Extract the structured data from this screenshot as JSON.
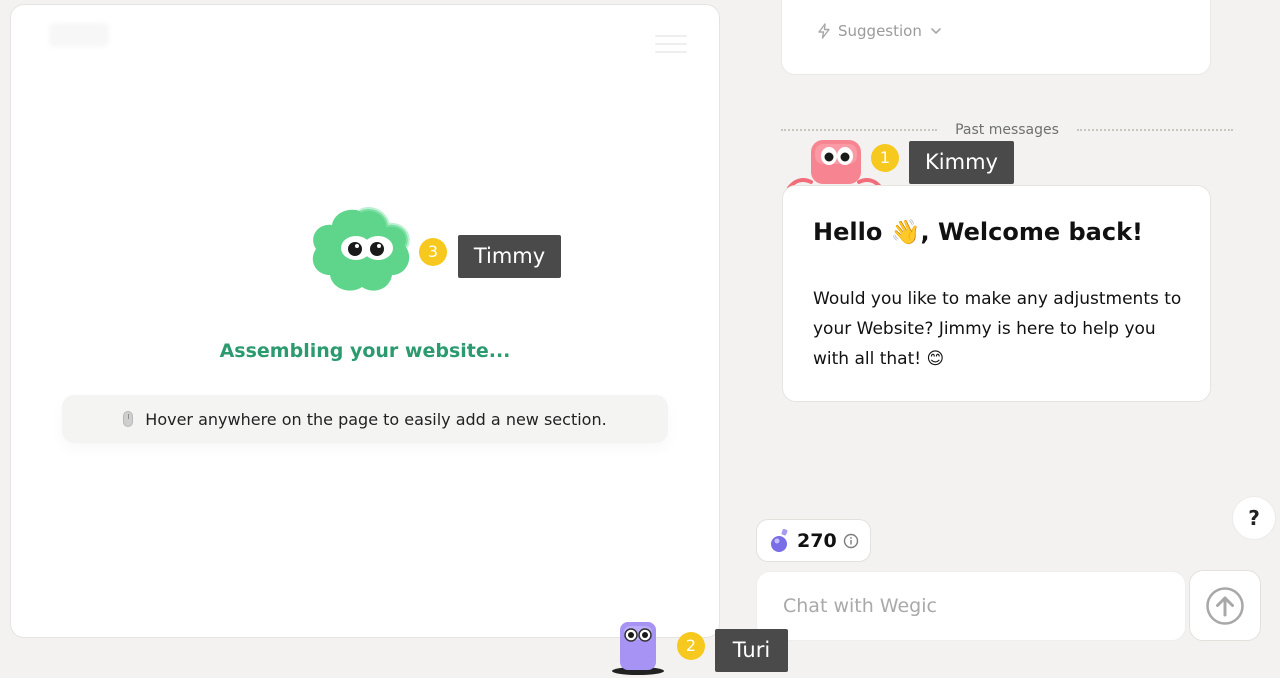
{
  "colors": {
    "accent_green": "#2b9a6f",
    "badge_yellow": "#f7c81e",
    "tag_dark": "#4a4a4a",
    "page_bg": "#f3f2f0"
  },
  "preview": {
    "timmy": {
      "badge": "3",
      "name": "Timmy"
    },
    "status": "Assembling your website...",
    "hint": "Hover anywhere on the page to easily add a new section."
  },
  "chat": {
    "suggestion_label": "Suggestion",
    "past_messages_label": "Past messages",
    "kimmy": {
      "badge": "1",
      "name": "Kimmy"
    },
    "message": {
      "title": "Hello 👋, Welcome back!",
      "body": "Would you like to make any adjustments to your Website? Jimmy is here to help you with all that! 😊"
    },
    "help_label": "?",
    "credits": "270",
    "input_placeholder": "Chat with Wegic"
  },
  "turi": {
    "badge": "2",
    "name": "Turi"
  },
  "icons": {
    "hamburger": "menu-icon",
    "suggestion": "lightning-icon",
    "dropdown": "chevron-down-icon",
    "hint": "mouse-icon",
    "credits": "potion-icon",
    "info": "info-icon",
    "send": "arrow-up-circle-icon"
  }
}
